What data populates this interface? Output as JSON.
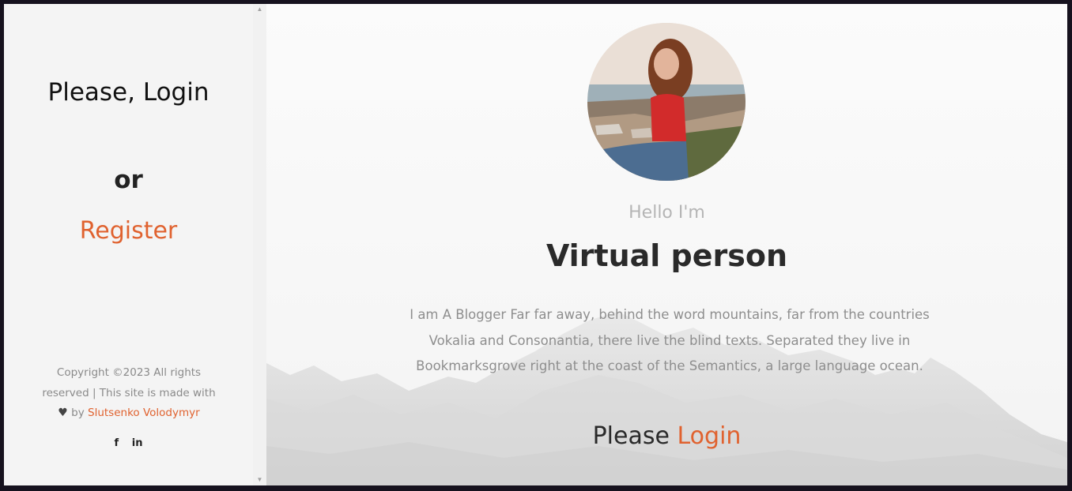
{
  "sidebar": {
    "login_heading": "Please, Login",
    "or_text": "or",
    "register_label": "Register",
    "copyright_text": "Copyright ©2023 All rights reserved | This site is made with",
    "by_text": "by",
    "author_name": "Slutsenko Volodymyr",
    "heart_icon": "heart-icon",
    "socials": [
      {
        "icon": "facebook-icon",
        "glyph": "f"
      },
      {
        "icon": "linkedin-icon",
        "glyph": "in"
      }
    ]
  },
  "main": {
    "greeting": "Hello I'm",
    "name": "Virtual person",
    "bio": "I am A Blogger Far far away, behind the word mountains, far from the countries Vokalia and Consonantia, there live the blind texts. Separated they live in Bookmarksgrove right at the coast of the Semantics, a large language ocean.",
    "cta_prefix": "Please",
    "cta_link": "Login"
  },
  "colors": {
    "accent": "#e0622f",
    "sidebar_bg": "#f4f4f4",
    "heading": "#2a2a2a",
    "muted": "#8e8e8e"
  }
}
